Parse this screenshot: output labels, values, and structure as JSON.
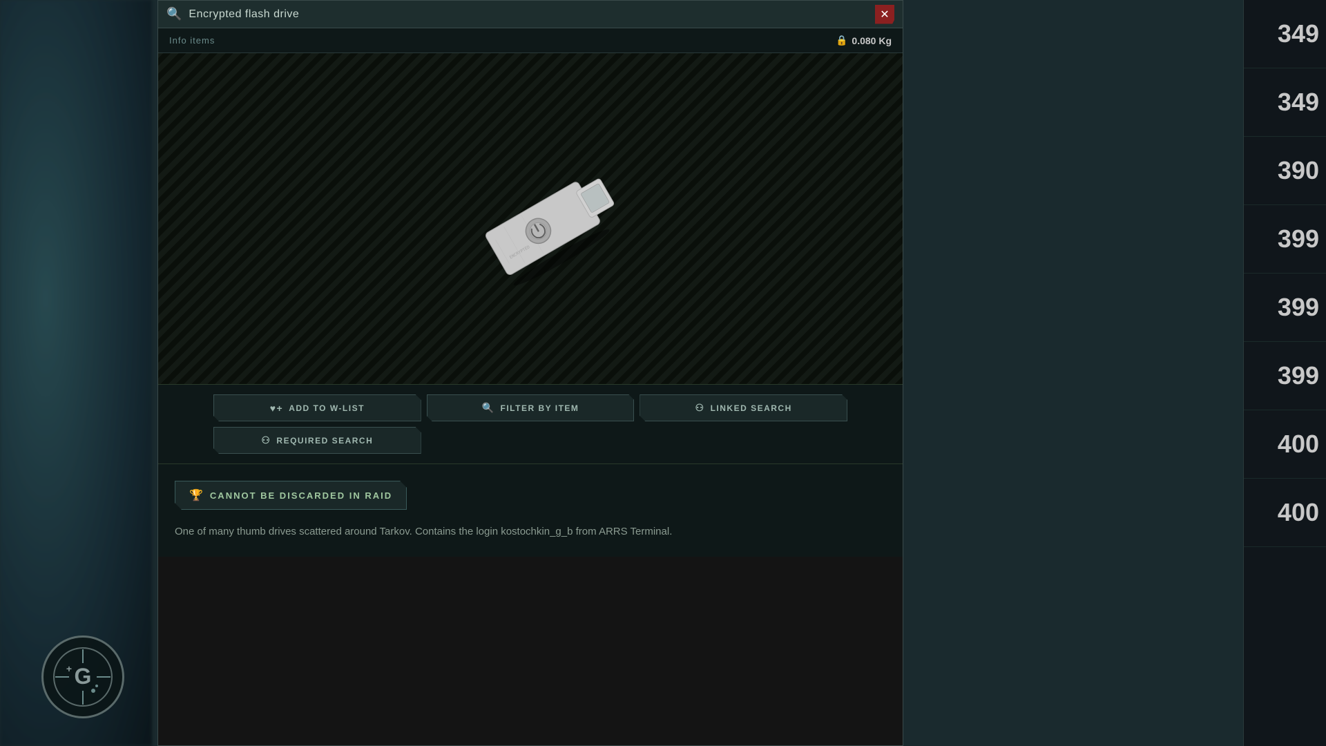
{
  "window": {
    "title": "Encrypted flash drive",
    "close_label": "✕"
  },
  "subheader": {
    "category": "Info items",
    "weight": "0.080 Kg"
  },
  "actions": {
    "add_to_wlist": "ADD TO W-LIST",
    "filter_by_item": "FILTER BY ITEM",
    "linked_search": "LINKED SEARCH",
    "required_search": "REQUIRED SEARCH"
  },
  "badge": {
    "cannot_discard": "CANNOT BE DISCARDED IN RAID"
  },
  "description": "One of many thumb drives scattered around Tarkov. Contains the login kostochkin_g_b from ARRS Terminal.",
  "right_numbers": [
    "349",
    "349",
    "390",
    "399",
    "399",
    "399",
    "400",
    "400"
  ],
  "icons": {
    "search": "🔍",
    "lock": "🔒",
    "heart_plus": "♥+",
    "magnify_search": "🔍",
    "link": "⚇",
    "required": "⚇",
    "trophy": "🏆"
  }
}
